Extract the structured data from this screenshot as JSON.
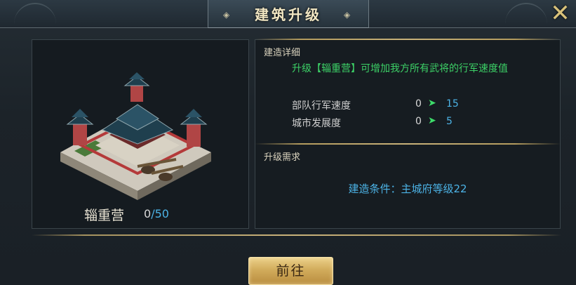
{
  "dialog": {
    "title": "建筑升级",
    "close_icon": "close-icon"
  },
  "building": {
    "name": "辎重营",
    "count_current": "0",
    "count_separator": "/",
    "count_max": "50"
  },
  "details": {
    "section_title": "建造详细",
    "description": "升级【辎重营】可增加我方所有武将的行军速度值",
    "stats": [
      {
        "label": "部队行军速度",
        "from": "0",
        "to": "15"
      },
      {
        "label": "城市发展度",
        "from": "0",
        "to": "5"
      }
    ]
  },
  "requirements": {
    "section_title": "升级需求",
    "condition": "建造条件：主城府等级22"
  },
  "actions": {
    "go_label": "前往"
  },
  "colors": {
    "accent_gold": "#c9b27a",
    "stat_value_blue": "#4cb3e6",
    "description_green": "#3cd066",
    "arrow_green": "#3ddc6a"
  }
}
